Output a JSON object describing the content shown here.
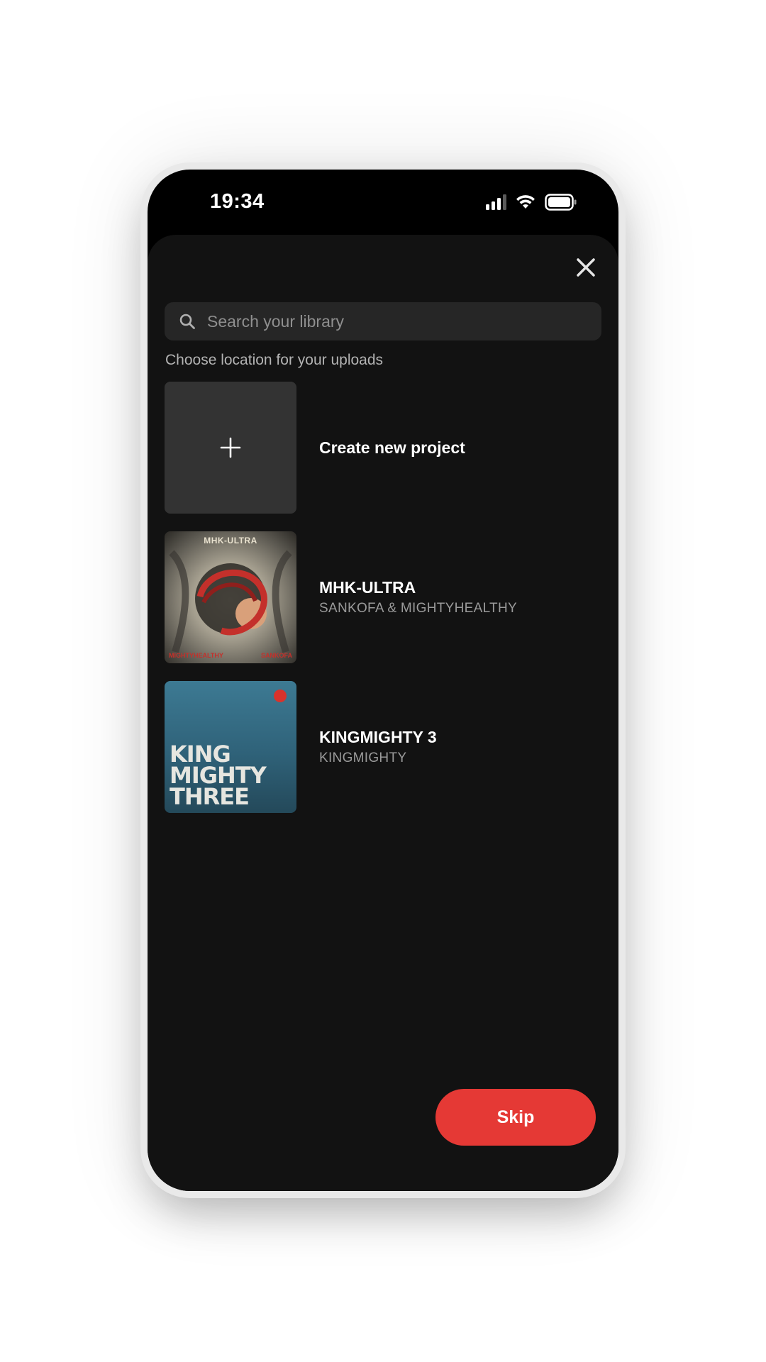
{
  "status_bar": {
    "time": "19:34",
    "signal_icon": "cellular-signal-icon",
    "wifi_icon": "wifi-icon",
    "battery_icon": "battery-icon"
  },
  "sheet": {
    "close_icon": "close-icon",
    "search": {
      "placeholder": "Search your library",
      "value": "",
      "icon": "search-icon"
    },
    "section_label": "Choose location for your uploads",
    "create_new": {
      "label": "Create new project",
      "icon": "plus-icon"
    },
    "projects": [
      {
        "title": "MHK-ULTRA",
        "artist": "SANKOFA & MIGHTYHEALTHY",
        "art_lines": [
          "MHK-ULTRA",
          "MIGHTYHEALTHY",
          "SANKOFA"
        ]
      },
      {
        "title": "KINGMIGHTY 3",
        "artist": "KINGMIGHTY",
        "art_lines": [
          "KING",
          "MIGHTY",
          "THREE"
        ]
      }
    ],
    "skip_label": "Skip"
  },
  "colors": {
    "accent": "#e53935",
    "sheet_background": "#121212",
    "search_background": "#262626"
  }
}
